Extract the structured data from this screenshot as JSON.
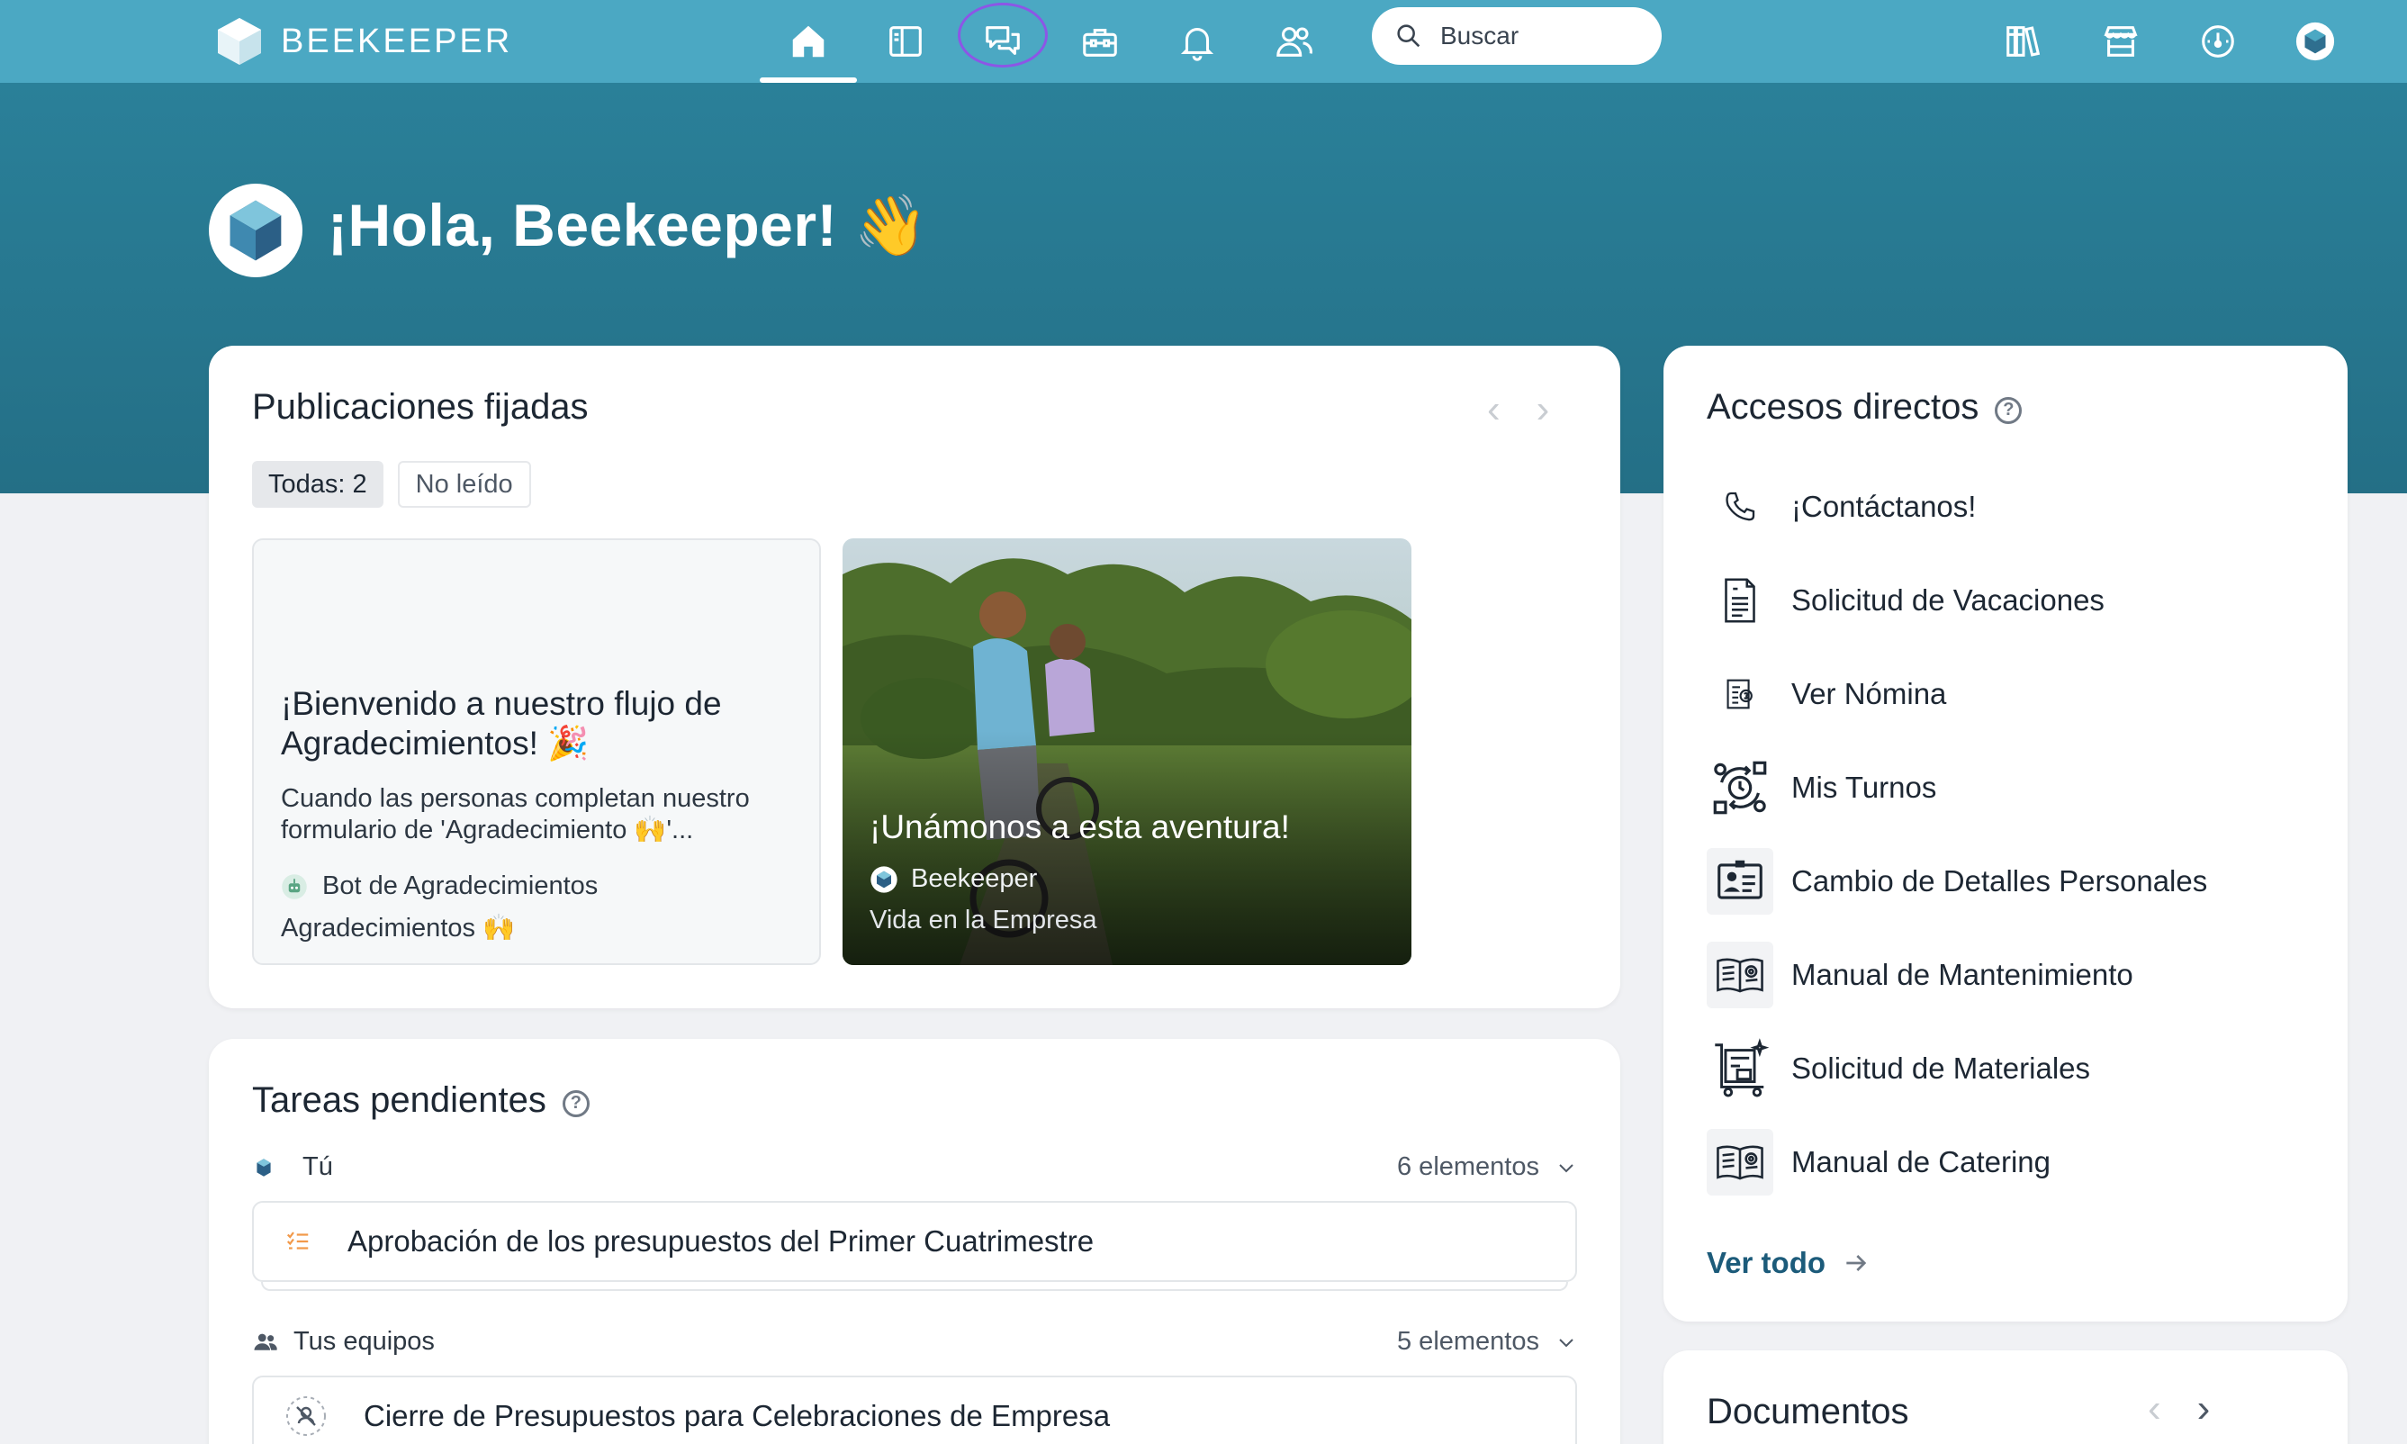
{
  "app": {
    "brand": "BEEKEEPER",
    "search_placeholder": "Buscar",
    "nav_icons": [
      "home-icon",
      "sidebar-icon",
      "chat-icon",
      "toolbox-icon",
      "bell-icon",
      "people-icon"
    ],
    "right_icons": [
      "library-icon",
      "store-icon",
      "dashboard-icon",
      "avatar"
    ],
    "colors": {
      "topbar": "#4ba8c3",
      "hero": "#246f86",
      "link": "#1c5b7a",
      "highlight_ring": "#8c56e6"
    }
  },
  "hero": {
    "greeting": "¡Hola, Beekeeper! 👋"
  },
  "pinned": {
    "title": "Publicaciones fijadas",
    "filters": [
      "Todas: 2",
      "No leído"
    ],
    "posts": [
      {
        "title": "¡Bienvenido a nuestro flujo de Agradecimientos! 🎉",
        "excerpt": "Cuando las personas completan nuestro formulario de 'Agradecimiento 🙌'...",
        "author": "Bot de Agradecimientos",
        "group": "Agradecimientos 🙌"
      },
      {
        "title": "¡Unámonos a esta aventura!",
        "author": "Beekeeper",
        "group": "Vida en la Empresa"
      }
    ]
  },
  "tasks": {
    "title": "Tareas pendientes",
    "groups": [
      {
        "label": "Tú",
        "count": "6 elementos",
        "first_task": "Aprobación de los presupuestos del Primer Cuatrimestre"
      },
      {
        "label": "Tus equipos",
        "count": "5 elementos",
        "first_task": "Cierre de Presupuestos para Celebraciones de Empresa"
      }
    ]
  },
  "shortcuts": {
    "title": "Accesos directos",
    "items": [
      {
        "label": "¡Contáctanos!",
        "icon": "phone-icon"
      },
      {
        "label": "Solicitud de Vacaciones",
        "icon": "document-icon"
      },
      {
        "label": "Ver Nómina",
        "icon": "payslip-icon"
      },
      {
        "label": "Mis Turnos",
        "icon": "shifts-icon"
      },
      {
        "label": "Cambio de Detalles Personales",
        "icon": "id-card-icon"
      },
      {
        "label": "Manual de Mantenimiento",
        "icon": "manual-icon"
      },
      {
        "label": "Solicitud de Materiales",
        "icon": "materials-icon"
      },
      {
        "label": "Manual de Catering",
        "icon": "manual-icon"
      }
    ],
    "see_all": "Ver todo"
  },
  "documents": {
    "title": "Documentos"
  }
}
